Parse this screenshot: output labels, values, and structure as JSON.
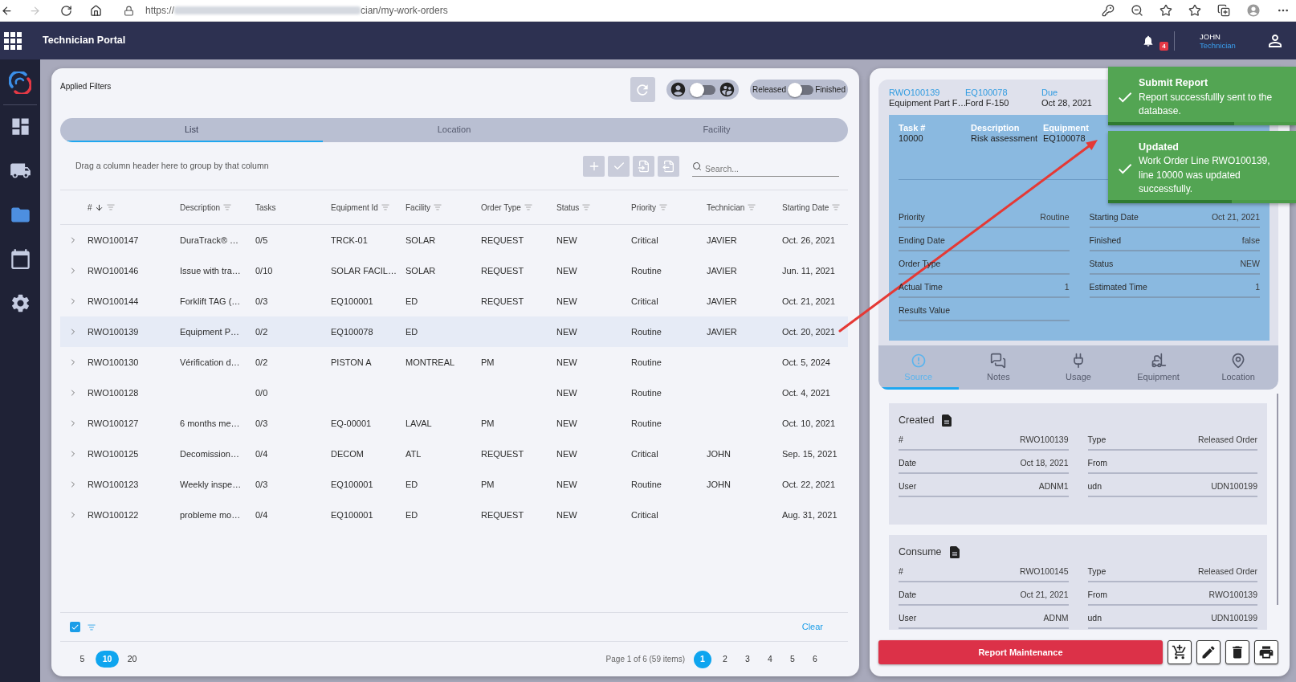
{
  "browser": {
    "url_start": "https://",
    "url_end": "cian/my-work-orders"
  },
  "header": {
    "title": "Technician Portal",
    "notification_count": "4",
    "user_name": "JOHN",
    "user_role": "Technician"
  },
  "sidebar": {
    "items": [
      {
        "selected": false
      },
      {
        "selected": false
      },
      {
        "selected": true
      },
      {
        "selected": false
      },
      {
        "selected": false
      }
    ]
  },
  "filters": {
    "label": "Applied Filters",
    "assignee_switch": {
      "on": false
    },
    "status_switch": {
      "off_label": "Released",
      "on_label": "Finished",
      "on": false
    }
  },
  "view_tabs": [
    {
      "label": "List",
      "selected": true
    },
    {
      "label": "Location",
      "selected": false
    },
    {
      "label": "Facility",
      "selected": false
    }
  ],
  "grid": {
    "group_hint": "Drag a column header here to group by that column",
    "search": {
      "placeholder": "Search..."
    },
    "columns": [
      {
        "label": "#",
        "sorted": true,
        "filterable": true
      },
      {
        "label": "Description",
        "sorted": false,
        "filterable": true
      },
      {
        "label": "Tasks",
        "sorted": false,
        "filterable": false
      },
      {
        "label": "Equipment Id",
        "sorted": false,
        "filterable": true
      },
      {
        "label": "Facility",
        "sorted": false,
        "filterable": true
      },
      {
        "label": "Order Type",
        "sorted": false,
        "filterable": true
      },
      {
        "label": "Status",
        "sorted": false,
        "filterable": true
      },
      {
        "label": "Priority",
        "sorted": false,
        "filterable": true
      },
      {
        "label": "Technician",
        "sorted": false,
        "filterable": true
      },
      {
        "label": "Starting Date",
        "sorted": false,
        "filterable": true
      }
    ],
    "rows": [
      {
        "selected": false,
        "expanded": false,
        "number": "RWO100147",
        "description": "DuraTrack® …",
        "tasks": "0/5",
        "equipment_id": "TRCK-01",
        "facility": "SOLAR",
        "order_type": "REQUEST",
        "status": "NEW",
        "priority": "Critical",
        "technician": "JAVIER",
        "starting_date": "Oct. 26, 2021"
      },
      {
        "selected": false,
        "expanded": false,
        "number": "RWO100146",
        "description": "Issue with tra…",
        "tasks": "0/10",
        "equipment_id": "SOLAR FACIL…",
        "facility": "SOLAR",
        "order_type": "REQUEST",
        "status": "NEW",
        "priority": "Routine",
        "technician": "JAVIER",
        "starting_date": "Jun. 11, 2021"
      },
      {
        "selected": false,
        "expanded": false,
        "number": "RWO100144",
        "description": "Forklift TAG (…",
        "tasks": "0/3",
        "equipment_id": "EQ100001",
        "facility": "ED",
        "order_type": "REQUEST",
        "status": "NEW",
        "priority": "Critical",
        "technician": "JAVIER",
        "starting_date": "Oct. 21, 2021"
      },
      {
        "selected": true,
        "expanded": false,
        "number": "RWO100139",
        "description": "Equipment P…",
        "tasks": "0/2",
        "equipment_id": "EQ100078",
        "facility": "ED",
        "status": "NEW",
        "priority": "Routine",
        "technician": "JAVIER",
        "starting_date": "Oct. 20, 2021"
      },
      {
        "selected": false,
        "expanded": false,
        "number": "RWO100130",
        "description": "Vérification d…",
        "tasks": "0/2",
        "equipment_id": "PISTON A",
        "facility": "MONTREAL",
        "order_type": "PM",
        "status": "NEW",
        "priority": "Routine",
        "starting_date": "Oct. 5, 2024"
      },
      {
        "selected": false,
        "expanded": false,
        "number": "RWO100128",
        "tasks": "0/0",
        "status": "NEW",
        "priority": "Routine",
        "starting_date": "Oct. 4, 2021"
      },
      {
        "selected": false,
        "expanded": false,
        "number": "RWO100127",
        "description": "6 months me…",
        "tasks": "0/3",
        "equipment_id": "EQ-00001",
        "facility": "LAVAL",
        "order_type": "PM",
        "status": "NEW",
        "priority": "Routine",
        "starting_date": "Oct. 10, 2021"
      },
      {
        "selected": false,
        "expanded": false,
        "number": "RWO100125",
        "description": "Decomission…",
        "tasks": "0/4",
        "equipment_id": "DECOM",
        "facility": "ATL",
        "order_type": "REQUEST",
        "status": "NEW",
        "priority": "Critical",
        "technician": "JOHN",
        "starting_date": "Sep. 15, 2021"
      },
      {
        "selected": false,
        "expanded": false,
        "number": "RWO100123",
        "description": "Weekly inspe…",
        "tasks": "0/3",
        "equipment_id": "EQ100001",
        "facility": "ED",
        "order_type": "PM",
        "status": "NEW",
        "priority": "Routine",
        "technician": "JOHN",
        "starting_date": "Oct. 22, 2021"
      },
      {
        "selected": false,
        "expanded": false,
        "number": "RWO100122",
        "description": "probleme mo…",
        "tasks": "0/4",
        "equipment_id": "EQ100001",
        "facility": "ED",
        "order_type": "REQUEST",
        "status": "NEW",
        "priority": "Critical",
        "starting_date": "Aug. 31, 2021"
      }
    ],
    "filter_row": {
      "checked": true,
      "clear": "Clear"
    },
    "page_sizes": [
      {
        "label": "5",
        "selected": false
      },
      {
        "label": "10",
        "selected": true
      },
      {
        "label": "20",
        "selected": false
      }
    ],
    "page_info": "Page 1 of 6 (59 items)",
    "pages": [
      {
        "label": "1",
        "selected": true
      },
      {
        "label": "2",
        "selected": false
      },
      {
        "label": "3",
        "selected": false
      },
      {
        "label": "4",
        "selected": false
      },
      {
        "label": "5",
        "selected": false
      },
      {
        "label": "6",
        "selected": false
      }
    ]
  },
  "detail": {
    "summary": [
      {
        "label": "RWO100139",
        "value": "Equipment Part F…"
      },
      {
        "label": "EQ100078",
        "value": "Ford F-150"
      },
      {
        "label": "Due",
        "value": "Oct 28, 2021"
      }
    ],
    "task": {
      "columns": [
        {
          "label": "Task #",
          "value": "10000"
        },
        {
          "label": "Description",
          "value": "Risk assessment"
        },
        {
          "label": "Equipment",
          "value": "EQ100078"
        }
      ],
      "fields": [
        {
          "label": "Priority",
          "value": "Routine"
        },
        {
          "label": "Starting Date",
          "value": "Oct 21, 2021"
        },
        {
          "label": "Ending Date"
        },
        {
          "label": "Finished",
          "value": "false"
        },
        {
          "label": "Order Type"
        },
        {
          "label": "Status",
          "value": "NEW"
        },
        {
          "label": "Actual Time",
          "value": "1"
        },
        {
          "label": "Estimated Time",
          "value": "1"
        },
        {
          "label": "Results Value"
        }
      ]
    },
    "tabs": [
      {
        "label": "Source",
        "selected": true
      },
      {
        "label": "Notes",
        "selected": false
      },
      {
        "label": "Usage",
        "selected": false
      },
      {
        "label": "Equipment",
        "selected": false
      },
      {
        "label": "Location",
        "selected": false
      }
    ],
    "sections": [
      {
        "title": "Created",
        "fields": [
          {
            "label": "#",
            "value": "RWO100139"
          },
          {
            "label": "Type",
            "value": "Released Order"
          },
          {
            "label": "Date",
            "value": "Oct 18, 2021"
          },
          {
            "label": "From"
          },
          {
            "label": "User",
            "value": "ADNM1"
          },
          {
            "label": "udn",
            "value": "UDN100199"
          }
        ]
      },
      {
        "title": "Consume",
        "fields": [
          {
            "label": "#",
            "value": "RWO100145"
          },
          {
            "label": "Type",
            "value": "Released Order"
          },
          {
            "label": "Date",
            "value": "Oct 21, 2021"
          },
          {
            "label": "From",
            "value": "RWO100139"
          },
          {
            "label": "User",
            "value": "ADNM"
          },
          {
            "label": "udn",
            "value": "UDN100199"
          }
        ]
      }
    ],
    "primary_action": "Report Maintenance"
  },
  "toasts": [
    {
      "title": "Submit Report",
      "message": "Report successfullly sent to the database.",
      "level": 0.67
    },
    {
      "title": "Updated",
      "message": "Work Order Line RWO100139, line 10000 was updated successfully.",
      "level": 0.66
    }
  ]
}
